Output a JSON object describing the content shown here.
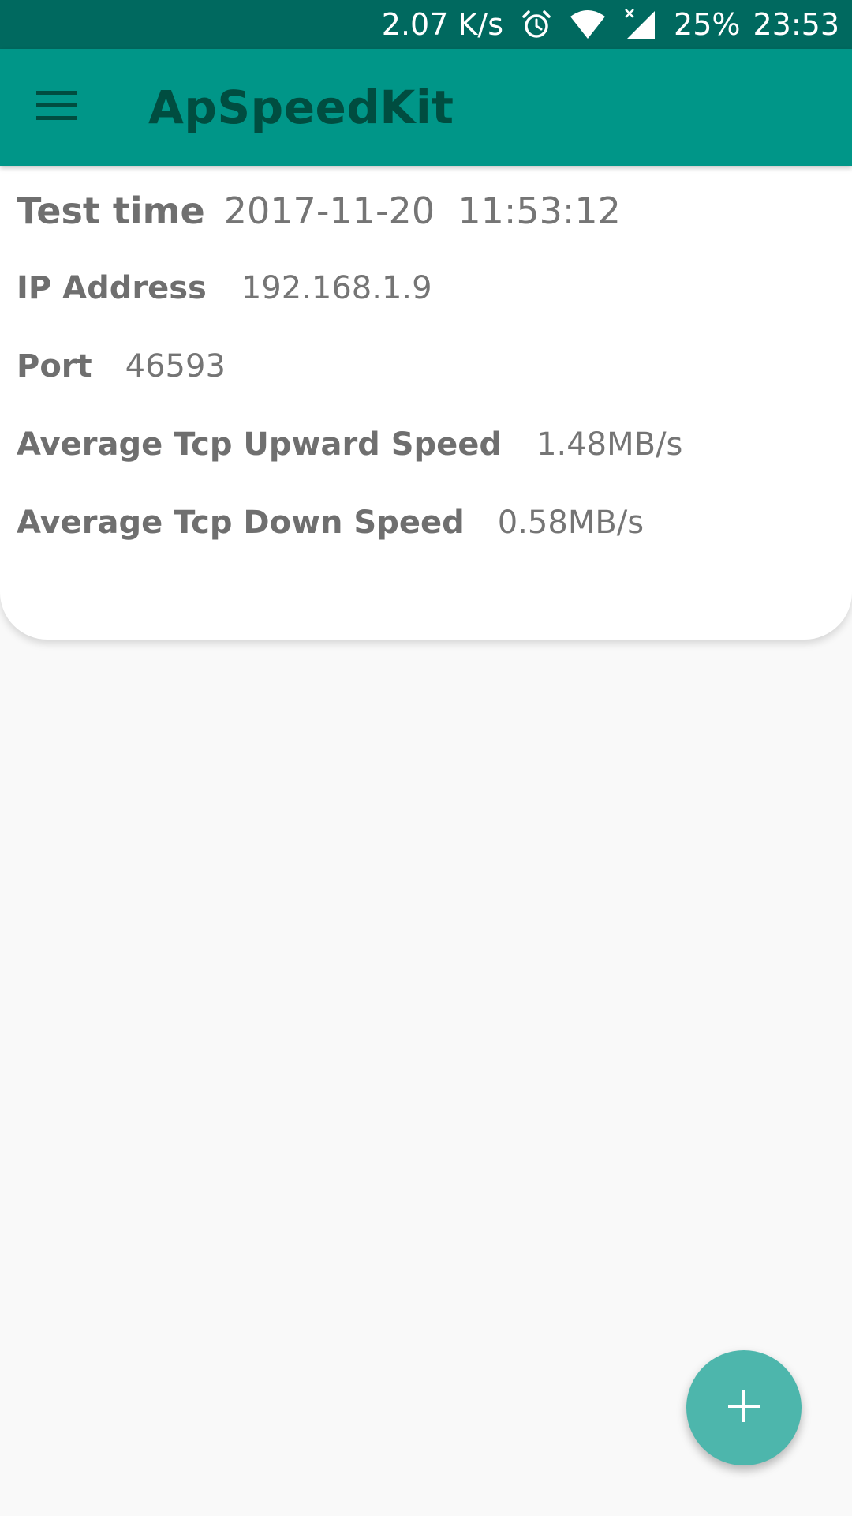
{
  "status_bar": {
    "network_speed": "2.07 K/s",
    "alarm_icon": "alarm-clock-icon",
    "wifi_icon": "wifi-icon",
    "signal_icon": "cell-signal-icon",
    "battery": "25%",
    "time": "23:53"
  },
  "app_bar": {
    "menu_icon": "hamburger-menu-icon",
    "title": "ApSpeedKit"
  },
  "result": {
    "test_time_label": "Test time",
    "test_time_value": "2017-11-20  11:53:12",
    "ip_label": "IP Address",
    "ip_value": "192.168.1.9",
    "port_label": "Port",
    "port_value": "46593",
    "up_speed_label": "Average Tcp Upward Speed",
    "up_speed_value": "1.48MB/s",
    "down_speed_label": "Average Tcp Down Speed",
    "down_speed_value": "0.58MB/s"
  },
  "fab": {
    "icon": "plus-icon"
  },
  "colors": {
    "status_bar": "#00695f",
    "app_bar": "#009688",
    "title_text": "#004d40",
    "fab": "#4db6ac",
    "background": "#f9f9f9"
  }
}
